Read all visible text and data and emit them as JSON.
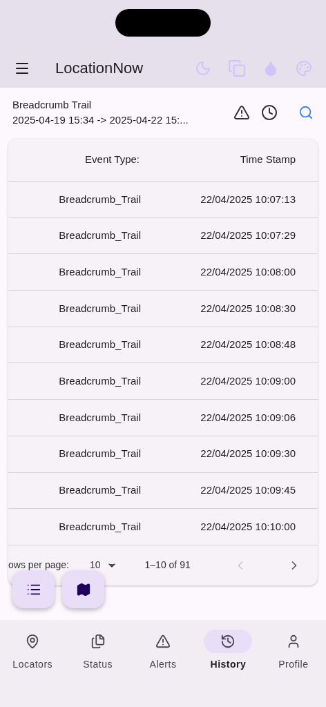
{
  "app_bar": {
    "title": "LocationNow"
  },
  "report": {
    "title": "Breadcrumb Trail",
    "range": "2025-04-19 15:34 -> 2025-04-22 15:..."
  },
  "table": {
    "columns": [
      "Event Type:",
      "Time Stamp"
    ],
    "rows": [
      [
        "Breadcrumb_Trail",
        "22/04/2025 10:07:13"
      ],
      [
        "Breadcrumb_Trail",
        "22/04/2025 10:07:29"
      ],
      [
        "Breadcrumb_Trail",
        "22/04/2025 10:08:00"
      ],
      [
        "Breadcrumb_Trail",
        "22/04/2025 10:08:30"
      ],
      [
        "Breadcrumb_Trail",
        "22/04/2025 10:08:48"
      ],
      [
        "Breadcrumb_Trail",
        "22/04/2025 10:09:00"
      ],
      [
        "Breadcrumb_Trail",
        "22/04/2025 10:09:06"
      ],
      [
        "Breadcrumb_Trail",
        "22/04/2025 10:09:30"
      ],
      [
        "Breadcrumb_Trail",
        "22/04/2025 10:09:45"
      ],
      [
        "Breadcrumb_Trail",
        "22/04/2025 10:10:00"
      ]
    ]
  },
  "pagination": {
    "rows_label": "ows per page:",
    "rows_value": "10",
    "range": "1–10 of 91",
    "prev_disabled": true,
    "next_disabled": false
  },
  "nav": [
    {
      "label": "Locators",
      "kind": "pin",
      "selected": false
    },
    {
      "label": "Status",
      "kind": "status",
      "selected": false
    },
    {
      "label": "Alerts",
      "kind": "alert",
      "selected": false
    },
    {
      "label": "History",
      "kind": "history",
      "selected": true
    },
    {
      "label": "Profile",
      "kind": "profile",
      "selected": false
    }
  ]
}
